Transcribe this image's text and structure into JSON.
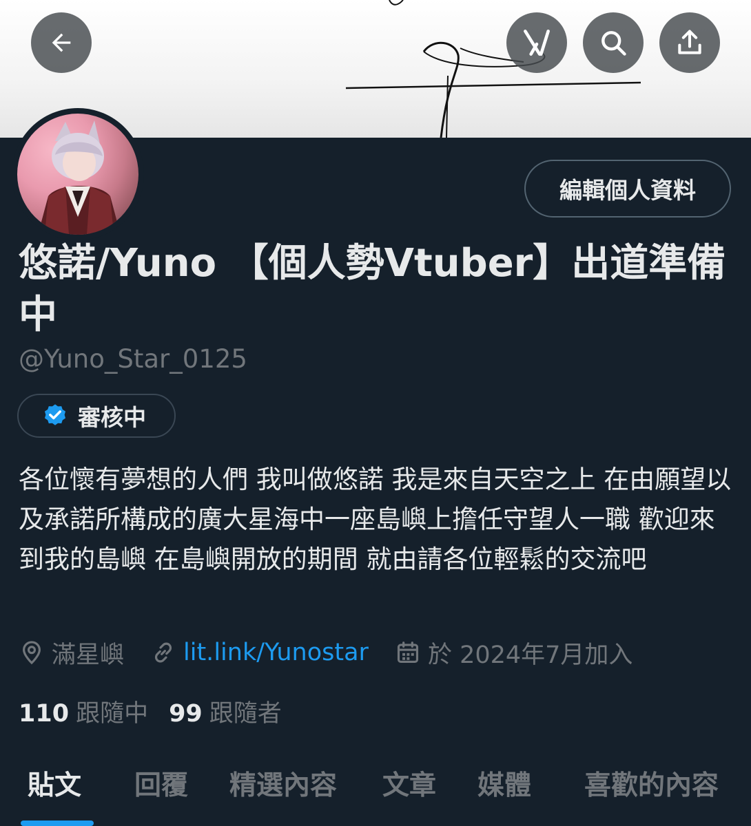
{
  "header": {
    "back_icon": "arrow-left-icon",
    "grok_icon": "grok-icon",
    "search_icon": "search-icon",
    "share_icon": "share-icon"
  },
  "profile": {
    "edit_profile_label": "編輯個人資料",
    "display_name": "悠諾/Yuno 【個人勢Vtuber】出道準備中",
    "handle": "@Yuno_Star_0125",
    "verification_label": "審核中",
    "bio": "各位懷有夢想的人們 我叫做悠諾 我是來自天空之上 在由願望以及承諾所構成的廣大星海中一座島嶼上擔任守望人一職 歡迎來到我的島嶼 在島嶼開放的期間 就由請各位輕鬆的交流吧",
    "location": "滿星嶼",
    "link": "lit.link/Yunostar",
    "joined": "於 2024年7月加入",
    "following_count": "110",
    "following_label": "跟隨中",
    "followers_count": "99",
    "followers_label": "跟隨者"
  },
  "tabs": [
    {
      "label": "貼文"
    },
    {
      "label": "回覆"
    },
    {
      "label": "精選內容"
    },
    {
      "label": "文章"
    },
    {
      "label": "媒體"
    },
    {
      "label": "喜歡的內容"
    }
  ],
  "colors": {
    "background": "#15202b",
    "accent": "#1d9bf0",
    "muted_text": "#71767b",
    "primary_text": "#e7e9ea"
  }
}
